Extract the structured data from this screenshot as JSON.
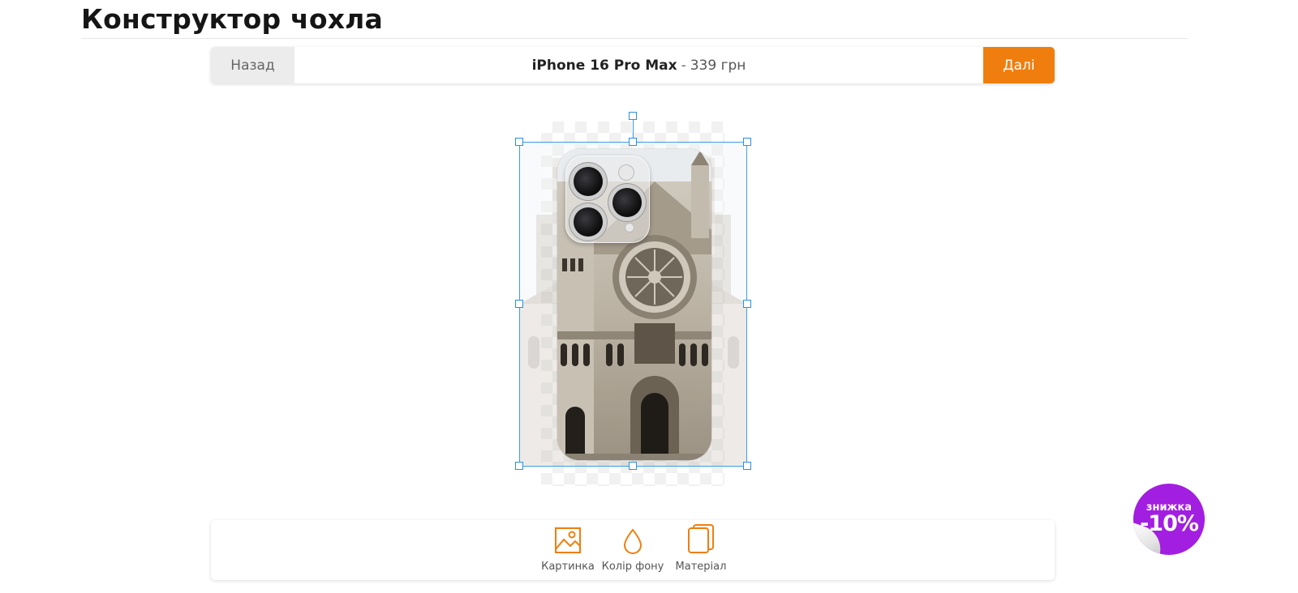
{
  "page": {
    "title": "Конструктор чохла"
  },
  "toolbar": {
    "back_label": "Назад",
    "product_model": "iPhone 16 Pro Max",
    "separator": "-",
    "price": "339 грн",
    "next_label": "Далі"
  },
  "tools": [
    {
      "label": "Картинка",
      "icon": "image-icon"
    },
    {
      "label": "Колір фону",
      "icon": "droplet-icon"
    },
    {
      "label": "Матеріал",
      "icon": "material-layers-icon"
    }
  ],
  "promo": {
    "small": "знижка",
    "big": "-10%"
  },
  "colors": {
    "accent": "#f07e0e",
    "selection": "#3a9fe8",
    "promo": "#a21ee0"
  }
}
